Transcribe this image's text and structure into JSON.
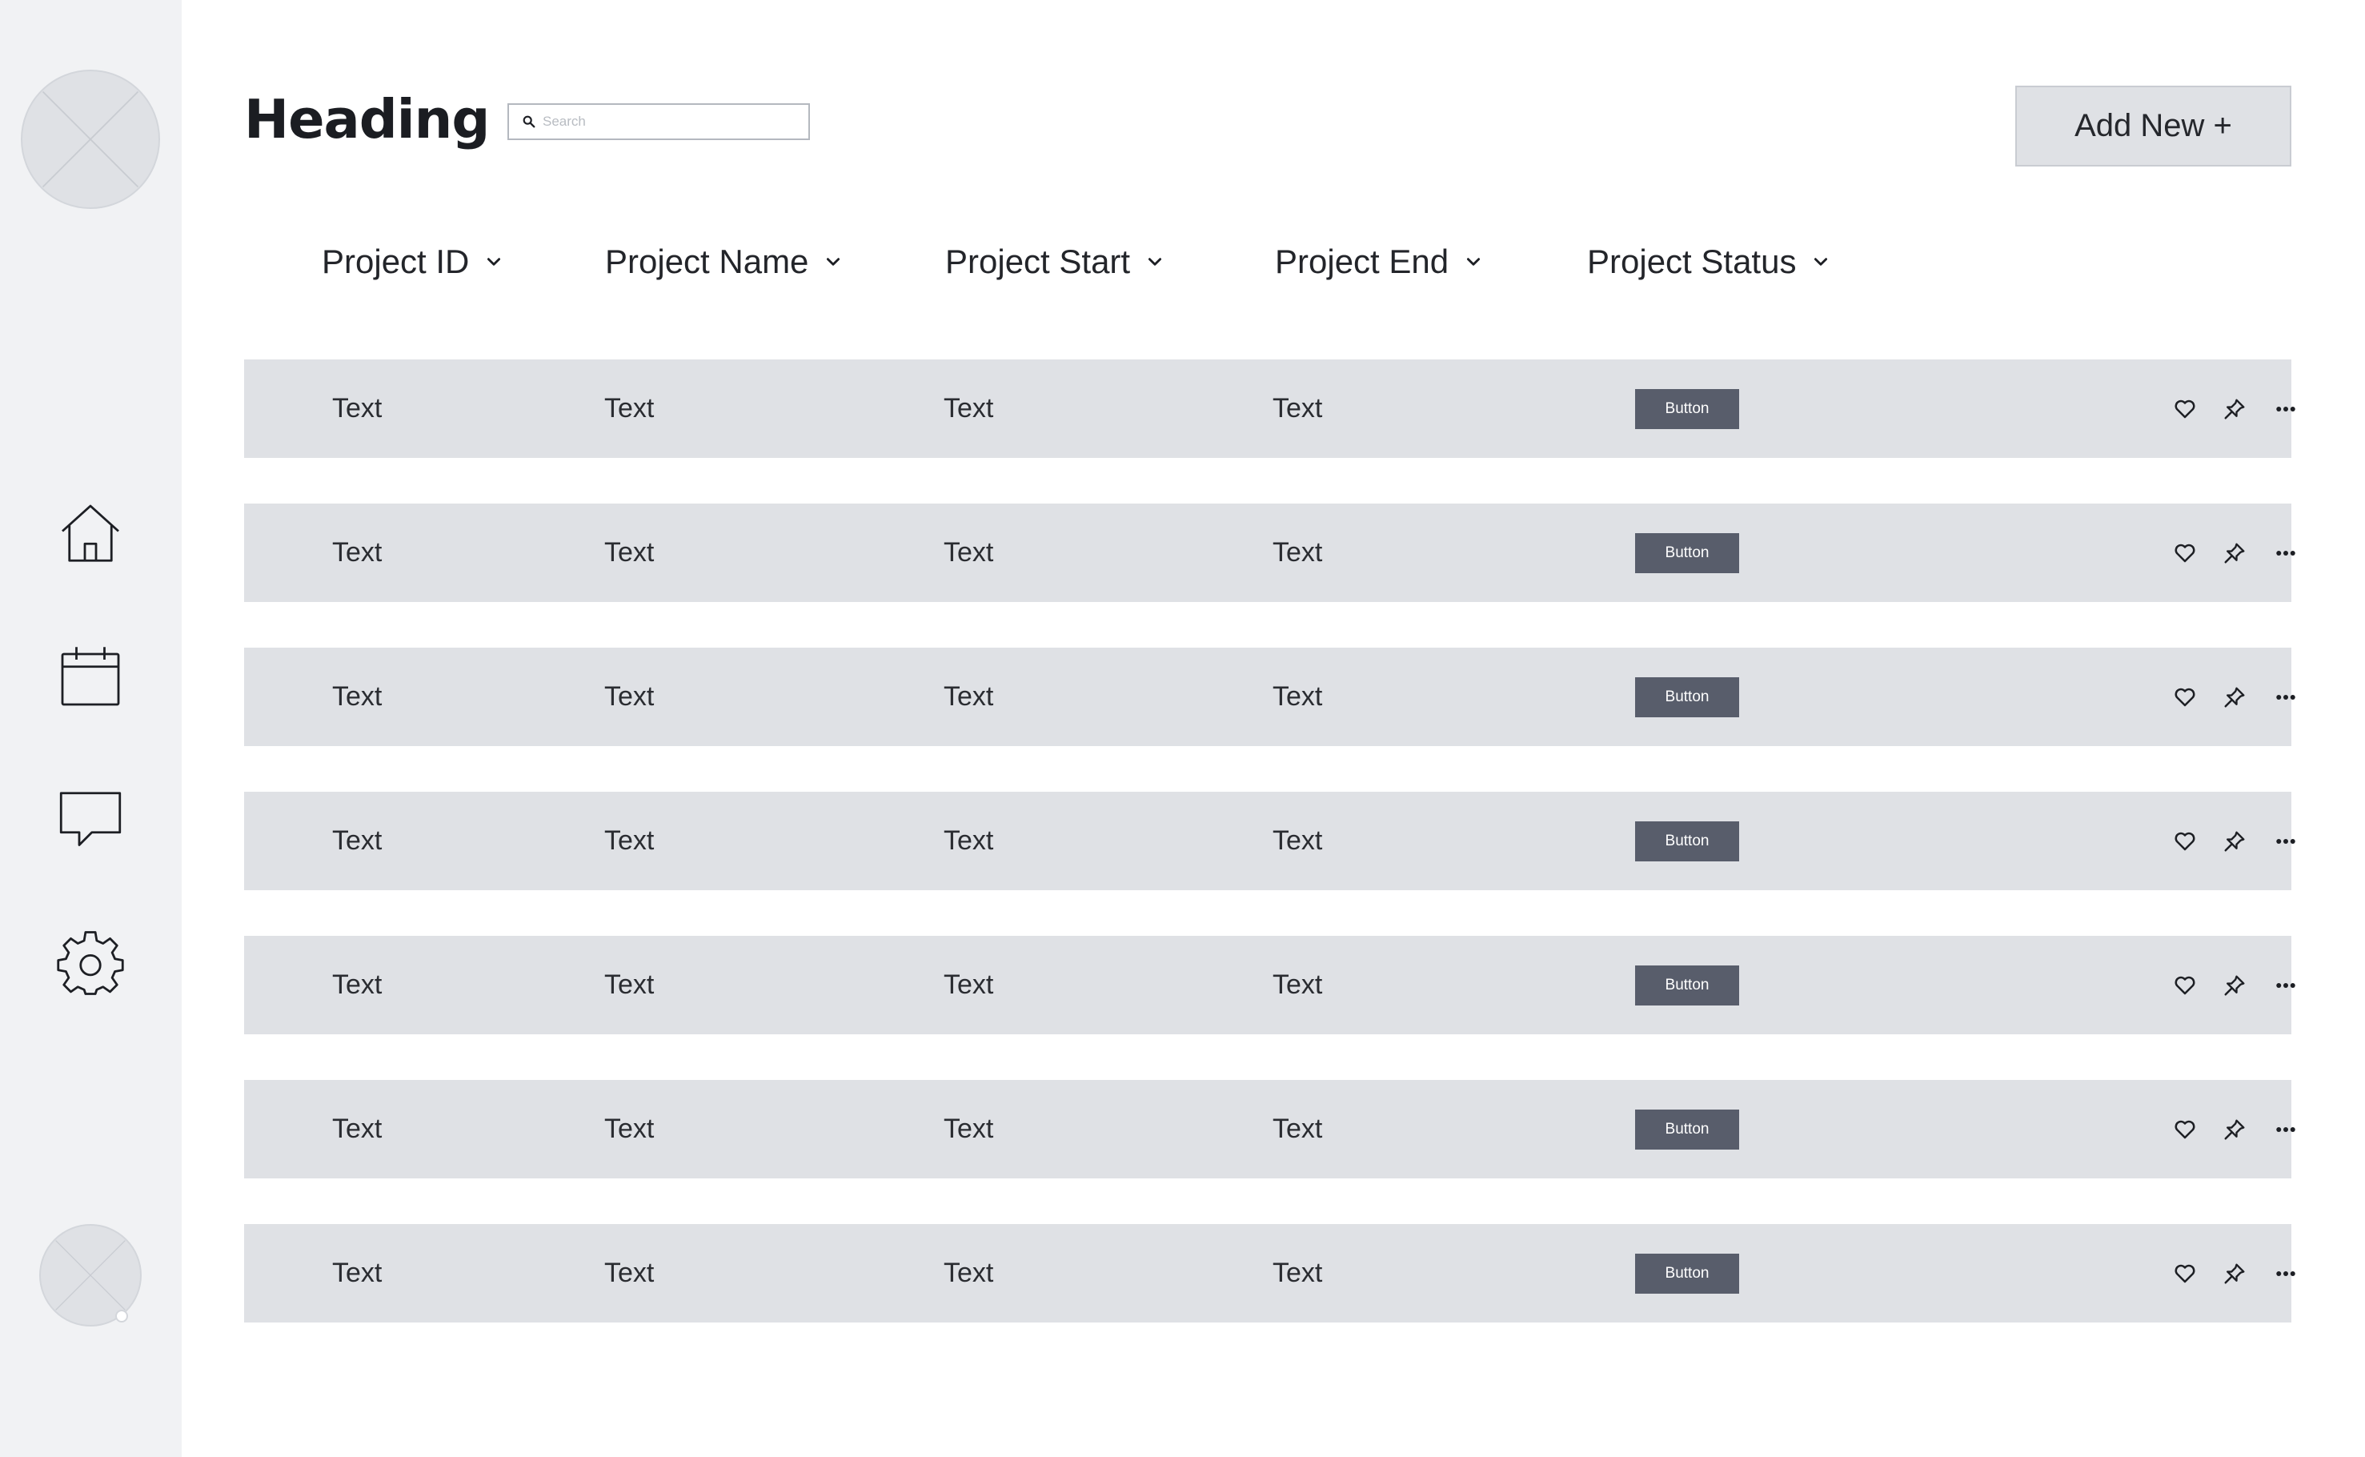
{
  "sidebar": {
    "profile_avatar": "placeholder-image",
    "nav_icons": [
      "home-icon",
      "calendar-icon",
      "chat-icon",
      "gear-icon"
    ],
    "user_avatar": "placeholder-image"
  },
  "header": {
    "title": "Heading",
    "search_placeholder": "Search",
    "add_button_label": "Add New +"
  },
  "table": {
    "columns": [
      "Project ID",
      "Project Name",
      "Project Start",
      "Project End",
      "Project Status"
    ],
    "rows": [
      {
        "id": "Text",
        "name": "Text",
        "start": "Text",
        "end": "Text",
        "status_button": "Button"
      },
      {
        "id": "Text",
        "name": "Text",
        "start": "Text",
        "end": "Text",
        "status_button": "Button"
      },
      {
        "id": "Text",
        "name": "Text",
        "start": "Text",
        "end": "Text",
        "status_button": "Button"
      },
      {
        "id": "Text",
        "name": "Text",
        "start": "Text",
        "end": "Text",
        "status_button": "Button"
      },
      {
        "id": "Text",
        "name": "Text",
        "start": "Text",
        "end": "Text",
        "status_button": "Button"
      },
      {
        "id": "Text",
        "name": "Text",
        "start": "Text",
        "end": "Text",
        "status_button": "Button"
      },
      {
        "id": "Text",
        "name": "Text",
        "start": "Text",
        "end": "Text",
        "status_button": "Button"
      }
    ],
    "row_actions": [
      "heart-icon",
      "pin-icon",
      "more-icon"
    ]
  },
  "colors": {
    "sidebar_bg": "#f1f2f4",
    "row_bg": "#dfe1e5",
    "status_button_bg": "#585d6b",
    "text": "#1d1f24"
  }
}
